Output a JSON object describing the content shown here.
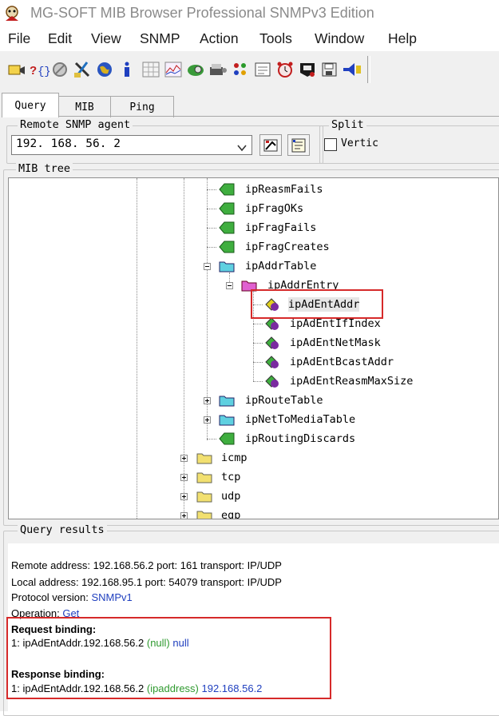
{
  "window": {
    "title": "MG-SOFT MIB Browser Professional SNMPv3 Edition"
  },
  "menu": [
    "File",
    "Edit",
    "View",
    "SNMP",
    "Action",
    "Tools",
    "Window",
    "Help"
  ],
  "toolbar": {
    "icons": [
      "contact-icon",
      "query-help-icon",
      "stop-icon",
      "tools-icon",
      "globe-icon",
      "info-icon",
      "table-icon",
      "graph-icon",
      "discovery-icon",
      "trap-icon",
      "dots-icon",
      "compile-icon",
      "clock-icon",
      "scan-icon",
      "save-icon",
      "trap-ringer-icon"
    ]
  },
  "tabs": [
    "Query",
    "MIB",
    "Ping"
  ],
  "agent": {
    "group_label": "Remote SNMP agent",
    "value": "192. 168. 56. 2"
  },
  "split": {
    "group_label": "Split",
    "option_label": "Vertic"
  },
  "tree": {
    "group_label": "MIB tree",
    "nodes": [
      "ipReasmFails",
      "ipFragOKs",
      "ipFragFails",
      "ipFragCreates",
      "ipAddrTable",
      "ipAddrEntry",
      "ipAdEntAddr",
      "ipAdEntIfIndex",
      "ipAdEntNetMask",
      "ipAdEntBcastAddr",
      "ipAdEntReasmMaxSize",
      "ipRouteTable",
      "ipNetToMediaTable",
      "ipRoutingDiscards",
      "icmp",
      "tcp",
      "udp",
      "egp"
    ]
  },
  "results": {
    "group_label": "Query results",
    "remote": "Remote address: 192.168.56.2  port: 161 transport: IP/UDP",
    "local": "Local address: 192.168.95.1  port: 54079 transport: IP/UDP",
    "protocol_label": "Protocol version: ",
    "protocol_value": "SNMPv1",
    "operation_label": "Operation: ",
    "operation_value": "Get",
    "request_heading": "Request binding:",
    "request_prefix": "1: ipAdEntAddr.192.168.56.2 ",
    "request_type": "(null)",
    "request_value": " null",
    "response_heading": "Response binding:",
    "response_prefix": "1: ipAdEntAddr.192.168.56.2 ",
    "response_type": "(ipaddress)",
    "response_value": " 192.168.56.2"
  },
  "colors": {
    "highlight": "#d62a2a",
    "value_blue": "#1f3fbf",
    "type_green": "#2f9a2f"
  }
}
